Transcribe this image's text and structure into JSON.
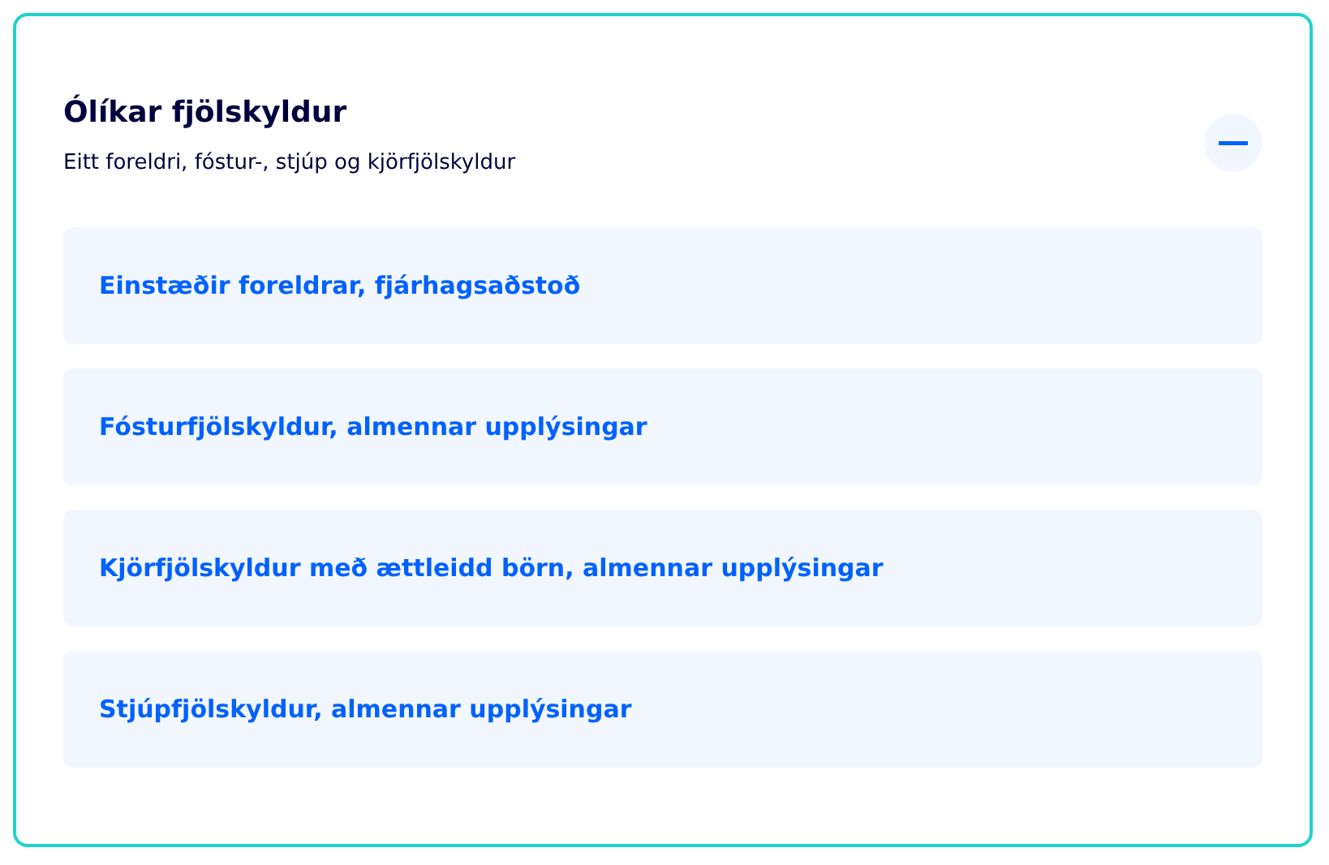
{
  "section": {
    "title": "Ólíkar fjölskyldur",
    "subtitle": "Eitt foreldri, fóstur-, stjúp og kjörfjölskyldur",
    "expanded": true,
    "links": [
      {
        "label": "Einstæðir foreldrar, fjárhagsaðstoð"
      },
      {
        "label": "Fósturfjölskyldur, almennar upplýsingar"
      },
      {
        "label": "Kjörfjölskyldur með ættleidd börn, almennar upplýsingar"
      },
      {
        "label": "Stjúpfjölskyldur, almennar upplýsingar"
      }
    ]
  }
}
